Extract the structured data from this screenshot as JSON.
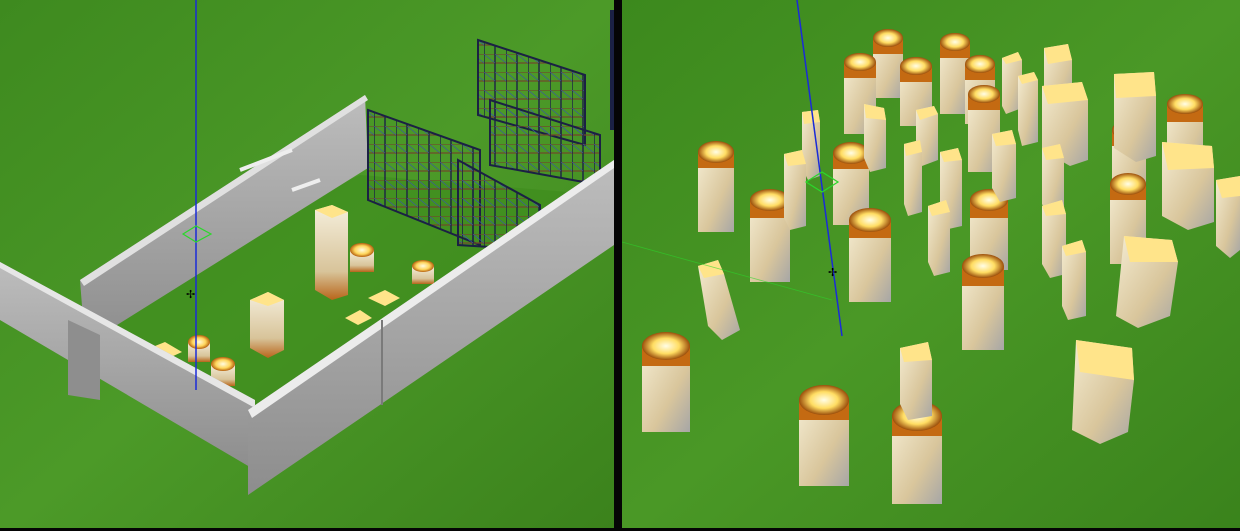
{
  "viewports": [
    {
      "name": "left-3d-viewport",
      "scene": "warehouse-walls-racks-pillars"
    },
    {
      "name": "right-3d-viewport",
      "scene": "pillar-field"
    }
  ],
  "colors": {
    "ground_light": "#4c9a28",
    "ground_dark": "#2e6a16",
    "wall_face": "#a9a9a9",
    "wall_top": "#d9d9d9",
    "rack_frame": "#1f2340",
    "pillar_top": "#fff2b0",
    "pillar_band": "#c46a12",
    "pillar_body": "#e6dcc2",
    "axis_blue": "#1a2bd8",
    "axis_green": "#2bd82b",
    "divider": "#050505"
  },
  "icons": [
    "move-gizmo-icon",
    "cursor-crosshair-icon"
  ]
}
